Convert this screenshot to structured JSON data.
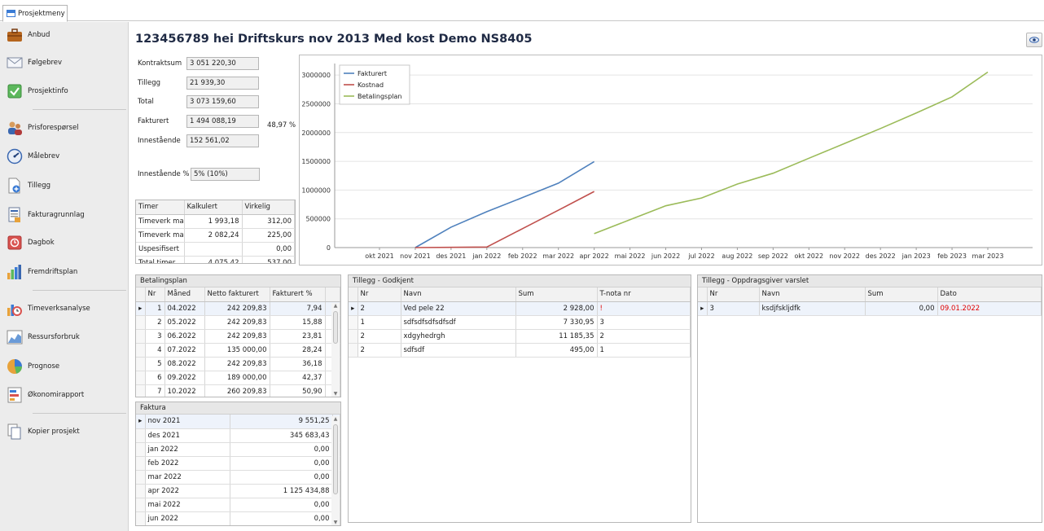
{
  "tab": {
    "label": "Prosjektmeny"
  },
  "sidebar": {
    "items": [
      {
        "label": "Anbud",
        "icon": "briefcase-icon"
      },
      {
        "label": "Følgebrev",
        "icon": "envelope-icon"
      },
      {
        "label": "Prosjektinfo",
        "icon": "checkmark-icon"
      },
      {
        "label": "Prisforespørsel",
        "icon": "people-icon"
      },
      {
        "label": "Målebrev",
        "icon": "gauge-icon"
      },
      {
        "label": "Tillegg",
        "icon": "document-add-icon"
      },
      {
        "label": "Fakturagrunnlag",
        "icon": "invoice-icon"
      },
      {
        "label": "Dagbok",
        "icon": "diary-icon"
      },
      {
        "label": "Fremdriftsplan",
        "icon": "bar-chart-icon"
      },
      {
        "label": "Timeverksanalyse",
        "icon": "timer-icon"
      },
      {
        "label": "Ressursforbruk",
        "icon": "area-chart-icon"
      },
      {
        "label": "Prognose",
        "icon": "pie-chart-icon"
      },
      {
        "label": "Økonomirapport",
        "icon": "report-icon"
      },
      {
        "label": "Kopier prosjekt",
        "icon": "copy-icon"
      }
    ]
  },
  "header": {
    "title": "123456789 hei  Driftskurs nov 2013 Med kost  Demo NS8405"
  },
  "summary": {
    "kontraktsum_label": "Kontraktsum",
    "kontraktsum": "3 051 220,30",
    "tillegg_label": "Tillegg",
    "tillegg": "21 939,30",
    "total_label": "Total",
    "total": "3 073 159,60",
    "fakturert_label": "Fakturert",
    "fakturert": "1 494 088,19",
    "fakturert_pct": "48,97 %",
    "innestaaende_label": "Innestående",
    "innestaaende": "152 561,02",
    "innestaaende_pct_label": "Innestående %",
    "innestaaende_pct": "5% (10%)"
  },
  "timer": {
    "headers": [
      "Timer",
      "Kalkulert",
      "Virkelig"
    ],
    "rows": [
      [
        "Timeverk ma...",
        "1 993,18",
        "312,00"
      ],
      [
        "Timeverk ma...",
        "2 082,24",
        "225,00"
      ],
      [
        "Uspesifisert",
        "",
        "0,00"
      ],
      [
        "Total timer",
        "4 075,42",
        "537,00"
      ]
    ]
  },
  "betalingsplan": {
    "title": "Betalingsplan",
    "headers": [
      "Nr",
      "Måned",
      "Netto fakturert",
      "Fakturert %"
    ],
    "rows": [
      [
        "1",
        "04.2022",
        "242 209,83",
        "7,94"
      ],
      [
        "2",
        "05.2022",
        "242 209,83",
        "15,88"
      ],
      [
        "3",
        "06.2022",
        "242 209,83",
        "23,81"
      ],
      [
        "4",
        "07.2022",
        "135 000,00",
        "28,24"
      ],
      [
        "5",
        "08.2022",
        "242 209,83",
        "36,18"
      ],
      [
        "6",
        "09.2022",
        "189 000,00",
        "42,37"
      ],
      [
        "7",
        "10.2022",
        "260 209,83",
        "50,90"
      ]
    ]
  },
  "faktura": {
    "title": "Faktura",
    "rows": [
      [
        "nov 2021",
        "9 551,25"
      ],
      [
        "des 2021",
        "345 683,43"
      ],
      [
        "jan 2022",
        "0,00"
      ],
      [
        "feb 2022",
        "0,00"
      ],
      [
        "mar 2022",
        "0,00"
      ],
      [
        "apr 2022",
        "1 125 434,88"
      ],
      [
        "mai 2022",
        "0,00"
      ],
      [
        "jun 2022",
        "0,00"
      ]
    ]
  },
  "tillegg_godkjent": {
    "title": "Tillegg - Godkjent",
    "headers": [
      "Nr",
      "Navn",
      "Sum",
      "T-nota nr"
    ],
    "rows": [
      [
        "2",
        "Ved pele 22",
        "2 928,00",
        "!"
      ],
      [
        "1",
        "sdfsdfsdfsdfsdf",
        "7 330,95",
        "3"
      ],
      [
        "2",
        "xdgyhedrgh",
        "11 185,35",
        "2"
      ],
      [
        "2",
        "sdfsdf",
        "495,00",
        "1"
      ]
    ]
  },
  "tillegg_varslet": {
    "title": "Tillegg - Oppdragsgiver varslet",
    "headers": [
      "Nr",
      "Navn",
      "Sum",
      "Dato"
    ],
    "rows": [
      [
        "3",
        "ksdjfskljdfk",
        "0,00",
        "09.01.2022"
      ]
    ]
  },
  "chart_data": {
    "type": "line",
    "x": [
      "okt 2021",
      "nov 2021",
      "des 2021",
      "jan 2022",
      "feb 2022",
      "mar 2022",
      "apr 2022",
      "mai 2022",
      "jun 2022",
      "jul 2022",
      "aug 2022",
      "sep 2022",
      "okt 2022",
      "nov 2022",
      "des 2022",
      "jan 2023",
      "feb 2023",
      "mar 2023"
    ],
    "ylim": [
      0,
      3200000
    ],
    "yticks": [
      "0",
      "500000",
      "1000000",
      "1500000",
      "2000000",
      "2500000",
      "3000000"
    ],
    "ytick_values": [
      0,
      500000,
      1000000,
      1500000,
      2000000,
      2500000,
      3000000
    ],
    "legend_position": "top-left",
    "series": [
      {
        "name": "Fakturert",
        "color": "#4f81bd",
        "x_index": [
          1,
          2,
          3,
          4,
          5,
          6
        ],
        "values": [
          0,
          355000,
          625000,
          870000,
          1120000,
          1494088
        ]
      },
      {
        "name": "Kostnad",
        "color": "#c0504d",
        "x_index": [
          1,
          2,
          3,
          4,
          5,
          6
        ],
        "values": [
          0,
          5000,
          10000,
          330000,
          650000,
          975000
        ]
      },
      {
        "name": "Betalingsplan",
        "color": "#9bbb59",
        "x_index": [
          6,
          7,
          8,
          9,
          10,
          11,
          12,
          13,
          14,
          15,
          16,
          17
        ],
        "values": [
          242210,
          484420,
          726630,
          861630,
          1103840,
          1292840,
          1553050,
          1810000,
          2070000,
          2340000,
          2620000,
          3051220
        ]
      }
    ]
  }
}
